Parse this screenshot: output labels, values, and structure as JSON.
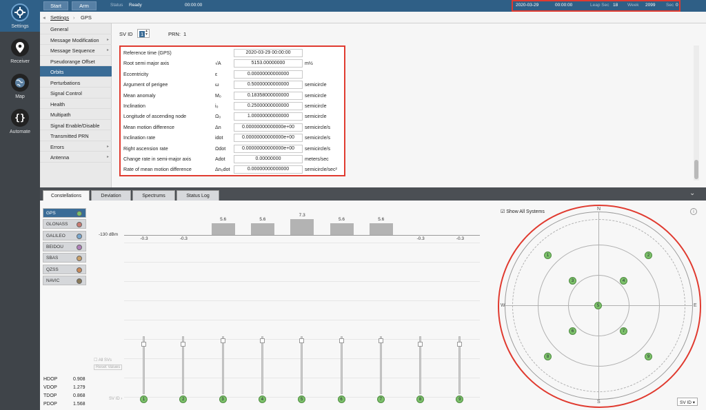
{
  "rail": {
    "items": [
      {
        "label": "Settings",
        "icon": "gear-icon"
      },
      {
        "label": "Receiver",
        "icon": "location-pin-icon"
      },
      {
        "label": "Map",
        "icon": "globe-icon"
      },
      {
        "label": "Automate",
        "icon": "braces-icon"
      }
    ]
  },
  "topbar": {
    "start_label": "Start",
    "arm_label": "Arm",
    "status_label": "Status",
    "status_value": "Ready",
    "elapsed": "00:00:00",
    "date": "2020-03-29",
    "time": "00:00:00",
    "leap_sec_label": "Leap Sec",
    "leap_sec_value": "18",
    "week_label": "Week",
    "week_value": "2099",
    "sec_label": "Sec",
    "sec_value": "0"
  },
  "breadcrumb": {
    "back": "◂",
    "root": "Settings",
    "sep": "›",
    "current": "GPS"
  },
  "menu": {
    "items": [
      {
        "label": "General"
      },
      {
        "label": "Message Modification",
        "arrow": "▸"
      },
      {
        "label": "Message Sequence",
        "arrow": "▸"
      },
      {
        "label": "Pseudorange Offset"
      },
      {
        "label": "Orbits"
      },
      {
        "label": "Perturbations"
      },
      {
        "label": "Signal Control"
      },
      {
        "label": "Health"
      },
      {
        "label": "Multipath"
      },
      {
        "label": "Signal Enable/Disable"
      },
      {
        "label": "Transmitted PRN"
      },
      {
        "label": "Errors",
        "arrow": "▸"
      },
      {
        "label": "Antenna",
        "arrow": "▸"
      }
    ],
    "active_index": 4
  },
  "sv": {
    "sv_id_label": "SV ID",
    "sv_id_value": "1",
    "prn_label": "PRN:",
    "prn_value": "1"
  },
  "params": [
    {
      "label": "Reference time (GPS)",
      "symbol": "",
      "value": "2020-03-29 00:00:00",
      "unit": ""
    },
    {
      "label": "Root semi major axis",
      "symbol": "√A",
      "value": "5153.00000000",
      "unit": "m½"
    },
    {
      "label": "Eccentricity",
      "symbol": "ε",
      "value": "0.00000000000000",
      "unit": ""
    },
    {
      "label": "Argument of perigee",
      "symbol": "ω",
      "value": "0.50000000000000",
      "unit": "semicircle"
    },
    {
      "label": "Mean anomaly",
      "symbol": "M₀",
      "value": "0.18358000000000",
      "unit": "semicircle"
    },
    {
      "label": "Inclination",
      "symbol": "i₀",
      "value": "0.25000000000000",
      "unit": "semicircle"
    },
    {
      "label": "Longitude of ascending node",
      "symbol": "Ω₀",
      "value": "1.00000000000000",
      "unit": "semicircle"
    },
    {
      "label": "Mean motion difference",
      "symbol": "Δn",
      "value": "0.00000000000000e+00",
      "unit": "semicircle/s"
    },
    {
      "label": "Inclination rate",
      "symbol": "idot",
      "value": "0.00000000000000e+00",
      "unit": "semicircle/s"
    },
    {
      "label": "Right ascension rate",
      "symbol": "Ωdot",
      "value": "0.00000000000000e+00",
      "unit": "semicircle/s"
    },
    {
      "label": "Change rate in semi-major axis",
      "symbol": "Adot",
      "value": "0.00000000",
      "unit": "meters/sec"
    },
    {
      "label": "Rate of mean motion difference",
      "symbol": "Δn₀dot",
      "value": "0.00000000000000",
      "unit": "semicircle/sec²"
    }
  ],
  "tabs": [
    {
      "label": "Constellations"
    },
    {
      "label": "Deviation"
    },
    {
      "label": "Spectrums"
    },
    {
      "label": "Status Log"
    }
  ],
  "collapse_icon": "chevron-down-icon",
  "constellations": [
    {
      "name": "GPS",
      "color": "#7cc06a"
    },
    {
      "name": "GLONASS",
      "color": "#c97b72"
    },
    {
      "name": "GALILEO",
      "color": "#79a7cf"
    },
    {
      "name": "BEIDOU",
      "color": "#b07fba"
    },
    {
      "name": "SBAS",
      "color": "#c9a06a"
    },
    {
      "name": "QZSS",
      "color": "#c98a5a"
    },
    {
      "name": "NAVIC",
      "color": "#8a7a5a"
    }
  ],
  "power": {
    "ref_label": "-130 dBm",
    "all_sv_label": "All SVs",
    "reset_label": "Reset Values",
    "sv_id_axis": "SV ID ›",
    "svs": [
      {
        "id": "1",
        "value": -0.3,
        "label": "-0.3"
      },
      {
        "id": "2",
        "value": -0.3,
        "label": "-0.3"
      },
      {
        "id": "3",
        "value": 5.6,
        "label": "5.6"
      },
      {
        "id": "4",
        "value": 5.6,
        "label": "5.6"
      },
      {
        "id": "5",
        "value": 7.3,
        "label": "7.3"
      },
      {
        "id": "6",
        "value": 5.6,
        "label": "5.6"
      },
      {
        "id": "7",
        "value": 5.6,
        "label": "5.6"
      },
      {
        "id": "8",
        "value": -0.3,
        "label": "-0.3"
      },
      {
        "id": "9",
        "value": -0.3,
        "label": "-0.3"
      }
    ]
  },
  "dop": [
    {
      "label": "HDOP",
      "value": "0.908"
    },
    {
      "label": "VDOP",
      "value": "1.279"
    },
    {
      "label": "TDOP",
      "value": "0.868"
    },
    {
      "label": "PDOP",
      "value": "1.568"
    }
  ],
  "sky": {
    "show_all_label": "Show All Systems",
    "info_icon": "info-icon",
    "north": "N",
    "south": "S",
    "east": "E",
    "west": "W",
    "sv_select": "SV ID",
    "satellites": [
      "1",
      "2",
      "3",
      "4",
      "5",
      "6",
      "7",
      "8",
      "9"
    ]
  }
}
